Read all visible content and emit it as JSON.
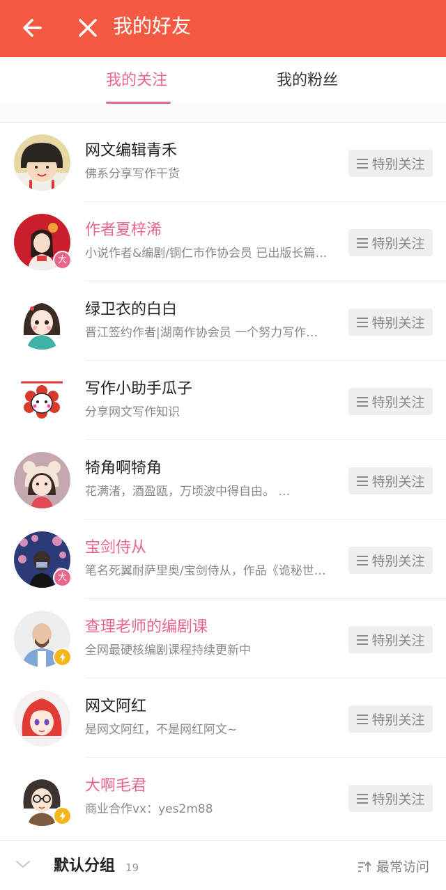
{
  "header": {
    "title": "我的好友",
    "background": "#f35a41",
    "back_icon": "arrow-left-icon",
    "close_icon": "close-icon"
  },
  "tabs": [
    {
      "label": "我的关注",
      "active": true
    },
    {
      "label": "我的粉丝",
      "active": false
    }
  ],
  "accent_color": "#e8668a",
  "follow_label": "特别关注",
  "friends": [
    {
      "name": "网文编辑青禾",
      "desc": "佛系分享写作干货",
      "highlight": false,
      "badge": ""
    },
    {
      "name": "作者夏梓浠",
      "desc": "小说作者&编剧/铜仁市作协会员 已出版长篇小说",
      "highlight": true,
      "badge": "大"
    },
    {
      "name": "绿卫衣的白白",
      "desc": "晋江签约作者|湖南作协会员 一个努力写作的人",
      "highlight": false,
      "badge": ""
    },
    {
      "name": "写作小助手瓜子",
      "desc": "分享网文写作知识",
      "highlight": false,
      "badge": ""
    },
    {
      "name": "犄角啊犄角",
      "desc": "花满渚，酒盈瓯，万顷波中得自由。 …",
      "highlight": false,
      "badge": ""
    },
    {
      "name": "宝剑侍从",
      "desc": "笔名死翼耐萨里奥/宝剑侍从，作品《诡秘世界》",
      "highlight": true,
      "badge": "大"
    },
    {
      "name": "查理老师的编剧课",
      "desc": "全网最硬核编剧课程持续更新中",
      "highlight": true,
      "badge": "bolt"
    },
    {
      "name": "网文阿红",
      "desc": "是网文阿红，不是网红阿文~",
      "highlight": false,
      "badge": ""
    },
    {
      "name": "大啊毛君",
      "desc": "商业合作vx：yes2m88",
      "highlight": true,
      "badge": "bolt"
    }
  ],
  "footer": {
    "group": "默认分组",
    "count": "19",
    "sort": "最常访问"
  }
}
